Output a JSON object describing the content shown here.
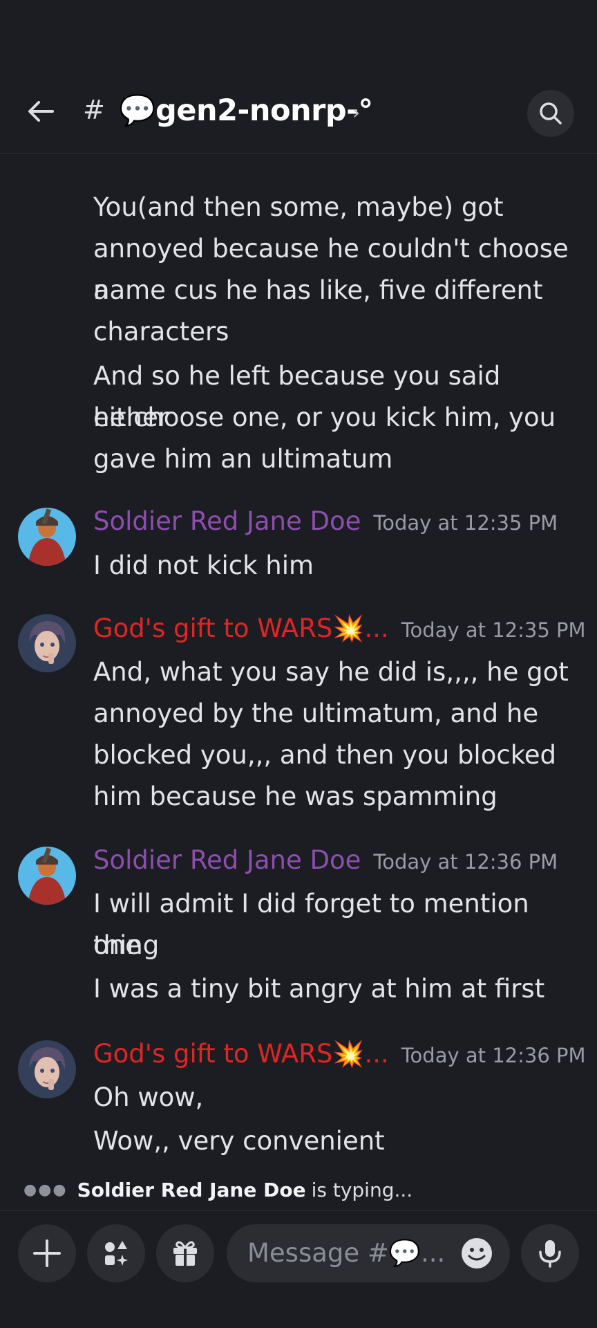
{
  "header": {
    "hash": "#",
    "channel": "💬gen2-nonrp-°",
    "chevron": "›"
  },
  "messages": [
    {
      "lines": [
        "You(and then some, maybe) got",
        "annoyed because he couldn't choose a",
        "name cus he has like, five different",
        "characters",
        "And so he left because you said either",
        "he choose one, or you kick him, you",
        "gave him an ultimatum"
      ]
    },
    {
      "author": "Soldier Red Jane Doe",
      "time": "Today at 12:35 PM",
      "lines": [
        "I did not kick him"
      ]
    },
    {
      "author": "God's gift to WARS💥...",
      "time": "Today at 12:35 PM",
      "lines": [
        "And, what you say he did is,,,, he got",
        "annoyed by the ultimatum, and he",
        "blocked you,,, and then you blocked",
        "him because he was spamming"
      ]
    },
    {
      "author": "Soldier Red Jane Doe",
      "time": "Today at 12:36 PM",
      "lines": [
        "I will admit I did forget to mention one",
        "thing",
        "I was a tiny bit angry at him at first"
      ]
    },
    {
      "author": "God's gift to WARS💥...",
      "time": "Today at 12:36 PM",
      "lines": [
        "Oh wow,",
        "Wow,, very convenient"
      ]
    }
  ],
  "typing": {
    "user": "Soldier Red Jane Doe",
    "text": "is typing..."
  },
  "composer": {
    "placeholder": "Message #💬..."
  },
  "colors": {
    "purple": "#8c4fb0",
    "red": "#e02525",
    "background": "#1c1d22"
  },
  "icons": [
    "back-arrow-icon",
    "search-icon",
    "plus-icon",
    "apps-icon",
    "gift-icon",
    "emoji-icon",
    "microphone-icon"
  ]
}
